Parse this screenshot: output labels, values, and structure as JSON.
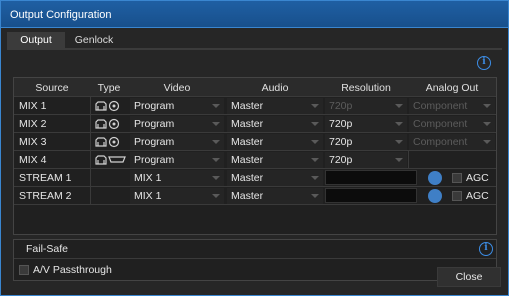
{
  "window": {
    "title": "Output Configuration"
  },
  "tabs": [
    {
      "label": "Output"
    },
    {
      "label": "Genlock"
    }
  ],
  "columns": {
    "source": "Source",
    "type": "Type",
    "video": "Video",
    "audio": "Audio",
    "resolution": "Resolution",
    "analog_out": "Analog Out"
  },
  "rows": [
    {
      "source": "MIX 1",
      "video": "Program",
      "audio": "Master",
      "resolution": "720p",
      "analog_out": "Component"
    },
    {
      "source": "MIX 2",
      "video": "Program",
      "audio": "Master",
      "resolution": "720p",
      "analog_out": "Component"
    },
    {
      "source": "MIX 3",
      "video": "Program",
      "audio": "Master",
      "resolution": "720p",
      "analog_out": "Component"
    },
    {
      "source": "MIX 4",
      "video": "Program",
      "audio": "Master",
      "resolution": "720p",
      "analog_out": ""
    },
    {
      "source": "STREAM 1",
      "video": "MIX 1",
      "audio": "Master",
      "agc": "AGC"
    },
    {
      "source": "STREAM 2",
      "video": "MIX 1",
      "audio": "Master",
      "agc": "AGC"
    }
  ],
  "failsafe": {
    "title": "Fail-Safe",
    "passthrough_label": "A/V Passthrough"
  },
  "buttons": {
    "close": "Close"
  },
  "icons": {
    "info": "i",
    "type_icons": [
      "monitor-icon",
      "disc-icon",
      "hdmi-icon"
    ]
  },
  "colors": {
    "accent": "#3c8de6",
    "titlebar": "#1f5fa3",
    "background": "#262626"
  }
}
